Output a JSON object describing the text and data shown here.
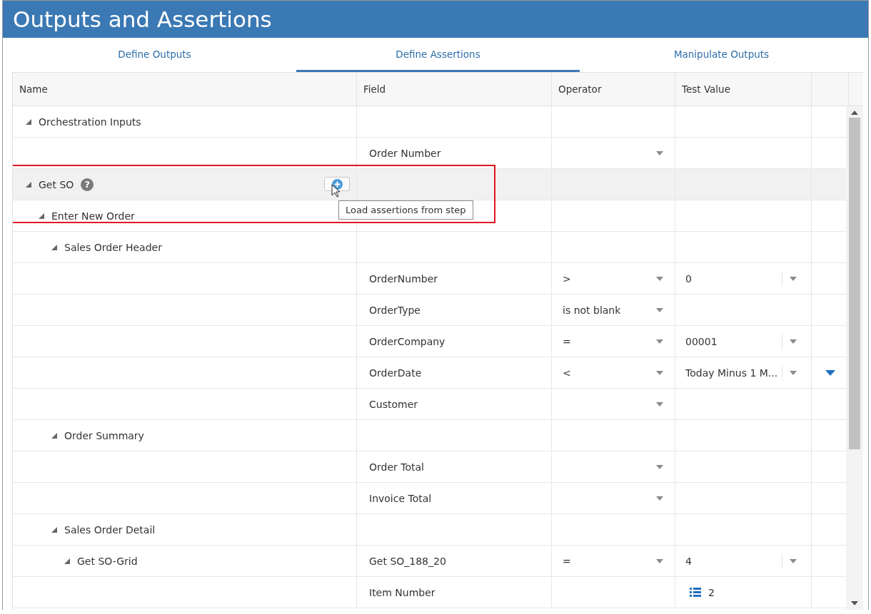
{
  "window": {
    "title": "Outputs and Assertions"
  },
  "tabs": [
    {
      "label": "Define Outputs",
      "selected": false
    },
    {
      "label": "Define Assertions",
      "selected": true
    },
    {
      "label": "Manipulate Outputs",
      "selected": false
    }
  ],
  "table": {
    "columns": [
      "Name",
      "Field",
      "Operator",
      "Test Value"
    ],
    "tree": [
      {
        "kind": "group",
        "name": "Orchestration Inputs",
        "expanded": true,
        "selected": false,
        "children": [
          {
            "kind": "field",
            "field": "Order Number",
            "operator_menu": true
          }
        ]
      },
      {
        "kind": "group",
        "name": "Get SO",
        "expanded": true,
        "selected": true,
        "help": "?",
        "framed": true,
        "add_button": {
          "tooltip": "Load assertions from step"
        },
        "children": [
          {
            "kind": "group",
            "name": "Enter New Order",
            "expanded": true,
            "selected": false,
            "children": [
              {
                "kind": "group",
                "name": "Sales Order Header",
                "expanded": true,
                "selected": false,
                "children": [
                  {
                    "kind": "field",
                    "field": "OrderNumber",
                    "operator_menu": true,
                    "operator": ">",
                    "test_value": {
                      "kind": "dropdown",
                      "value": "0"
                    }
                  },
                  {
                    "kind": "field",
                    "field": "OrderType",
                    "operator_menu": true,
                    "operator": "is not blank"
                  },
                  {
                    "kind": "field",
                    "field": "OrderCompany",
                    "operator_menu": true,
                    "operator": "=",
                    "test_value": {
                      "kind": "dropdown",
                      "value": "00001"
                    }
                  },
                  {
                    "kind": "field",
                    "field": "OrderDate",
                    "operator_menu": true,
                    "operator": "<",
                    "test_value": {
                      "kind": "dropdown",
                      "value": "Today Minus 1 M..."
                    },
                    "row_menu": true
                  },
                  {
                    "kind": "field",
                    "field": "Customer",
                    "operator_menu": true
                  }
                ]
              },
              {
                "kind": "group",
                "name": "Order Summary",
                "expanded": true,
                "selected": false,
                "children": [
                  {
                    "kind": "field",
                    "field": "Order Total",
                    "operator_menu": true
                  },
                  {
                    "kind": "field",
                    "field": "Invoice Total",
                    "operator_menu": true
                  }
                ]
              },
              {
                "kind": "group",
                "name": "Sales Order Detail",
                "expanded": true,
                "selected": false,
                "children": [
                  {
                    "kind": "group",
                    "name": "Get SO-Grid",
                    "expanded": true,
                    "selected": false,
                    "field": "Get SO_188_20",
                    "operator_menu": true,
                    "operator": "=",
                    "test_value": {
                      "kind": "dropdown",
                      "value": "4"
                    },
                    "children": [
                      {
                        "kind": "field",
                        "field": "Item Number",
                        "operator_menu": false,
                        "test_value": {
                          "kind": "list",
                          "value": "2"
                        }
                      }
                    ]
                  }
                ]
              }
            ]
          }
        ]
      }
    ]
  }
}
